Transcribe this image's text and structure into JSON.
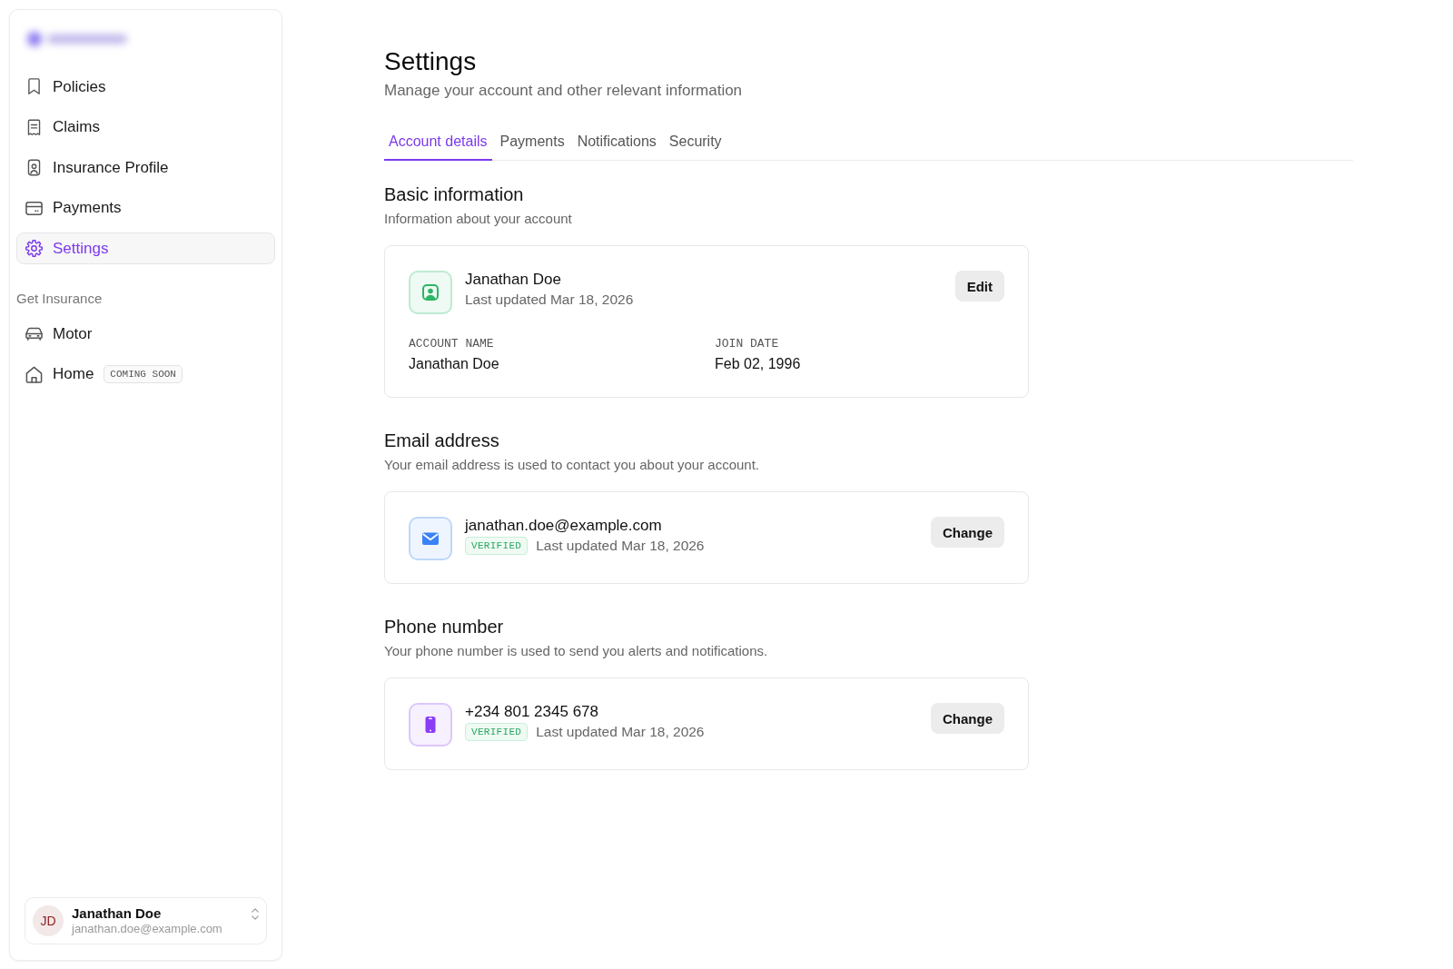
{
  "sidebar": {
    "nav_items": [
      {
        "label": "Policies",
        "selected": false
      },
      {
        "label": "Claims",
        "selected": false
      },
      {
        "label": "Insurance Profile",
        "selected": false
      },
      {
        "label": "Payments",
        "selected": false
      },
      {
        "label": "Settings",
        "selected": true
      }
    ],
    "section_label": "Get Insurance",
    "insurance_items": [
      {
        "label": "Motor",
        "selected": false
      },
      {
        "label": "Home",
        "selected": false,
        "badge": "COMING SOON"
      }
    ],
    "user": {
      "initials": "JD",
      "name": "Janathan Doe",
      "email": "janathan.doe@example.com"
    }
  },
  "header": {
    "title": "Settings",
    "subtitle": "Manage your account and other relevant information"
  },
  "tabs": [
    {
      "label": "Account details",
      "selected": true
    },
    {
      "label": "Payments",
      "selected": false
    },
    {
      "label": "Notifications",
      "selected": false
    },
    {
      "label": "Security",
      "selected": false
    }
  ],
  "sections": [
    {
      "kind": "profile",
      "heading": "Basic information",
      "description": "Information about your account",
      "card": {
        "title": "Janathan Doe",
        "updated": "Last updated Mar 18, 2026",
        "button": "Edit",
        "fields": [
          {
            "label": "ACCOUNT NAME",
            "value": "Janathan Doe"
          },
          {
            "label": "JOIN DATE",
            "value": "Feb 02, 1996"
          }
        ]
      }
    },
    {
      "kind": "email",
      "heading": "Email address",
      "description": "Your email address is used to contact you about your account.",
      "card": {
        "title": "janathan.doe@example.com",
        "badge": "VERIFIED",
        "updated": "Last updated Mar 18, 2026",
        "button": "Change"
      }
    },
    {
      "kind": "phone",
      "heading": "Phone number",
      "description": "Your phone number is used to send you alerts and notifications.",
      "card": {
        "title": "+234 801 2345 678",
        "badge": "VERIFIED",
        "updated": "Last updated Mar 18, 2026",
        "button": "Change"
      }
    }
  ]
}
